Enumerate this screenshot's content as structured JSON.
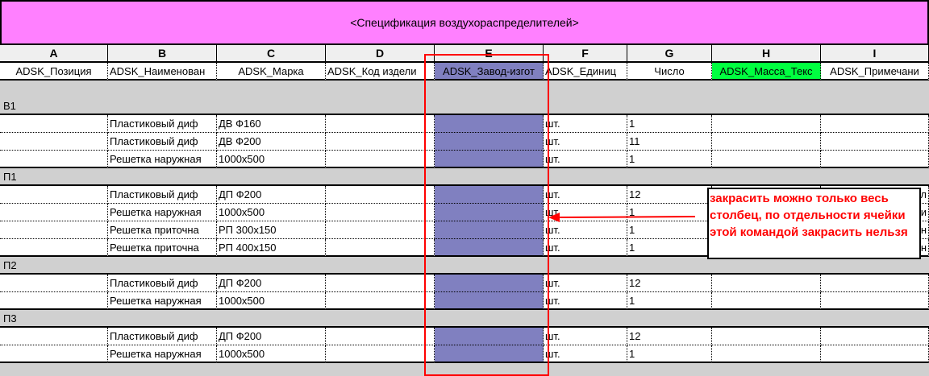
{
  "title": "<Спецификация воздухораспределителей>",
  "columns": [
    {
      "letter": "A",
      "header": "ADSK_Позиция"
    },
    {
      "letter": "B",
      "header": "ADSK_Наименован"
    },
    {
      "letter": "C",
      "header": "ADSK_Марка"
    },
    {
      "letter": "D",
      "header": "ADSK_Код издели"
    },
    {
      "letter": "E",
      "header": "ADSK_Завод-изгот"
    },
    {
      "letter": "F",
      "header": "ADSK_Единиц"
    },
    {
      "letter": "G",
      "header": "Число"
    },
    {
      "letter": "H",
      "header": "ADSK_Масса_Текс"
    },
    {
      "letter": "I",
      "header": "ADSK_Примечани"
    }
  ],
  "colors": {
    "title_bg": "#ff80ff",
    "column_e": "#8080c0",
    "column_h_header": "#00ff40",
    "annotation": "#ff0000"
  },
  "groups": [
    {
      "name": "В1",
      "rows": [
        [
          "",
          "Пластиковый диф",
          "ДВ Ф160",
          "",
          "",
          "шт.",
          "1",
          "",
          ""
        ],
        [
          "",
          "Пластиковый диф",
          "ДВ Ф200",
          "",
          "",
          "шт.",
          "11",
          "",
          ""
        ],
        [
          "",
          "Решетка наружная",
          "1000x500",
          "",
          "",
          "шт.",
          "1",
          "",
          ""
        ]
      ]
    },
    {
      "name": "П1",
      "rows": [
        [
          "",
          "Пластиковый диф",
          "ДП Ф200",
          "",
          "",
          "шт.",
          "12",
          "",
          "л"
        ],
        [
          "",
          "Решетка наружная",
          "1000x500",
          "",
          "",
          "шт.",
          "1",
          "",
          "и"
        ],
        [
          "",
          "Решетка приточна",
          "РП 300x150",
          "",
          "",
          "шт.",
          "1",
          "",
          "н"
        ],
        [
          "",
          "Решетка приточна",
          "РП 400x150",
          "",
          "",
          "шт.",
          "1",
          "",
          "н"
        ]
      ]
    },
    {
      "name": "П2",
      "rows": [
        [
          "",
          "Пластиковый диф",
          "ДП Ф200",
          "",
          "",
          "шт.",
          "12",
          "",
          ""
        ],
        [
          "",
          "Решетка наружная",
          "1000x500",
          "",
          "",
          "шт.",
          "1",
          "",
          ""
        ]
      ]
    },
    {
      "name": "П3",
      "rows": [
        [
          "",
          "Пластиковый диф",
          "ДП Ф200",
          "",
          "",
          "шт.",
          "12",
          "",
          ""
        ],
        [
          "",
          "Решетка наружная",
          "1000x500",
          "",
          "",
          "шт.",
          "1",
          "",
          ""
        ]
      ]
    }
  ],
  "annotation": "закрасить можно только весь столбец, по отдельности ячейки этой командой закрасить нельзя"
}
